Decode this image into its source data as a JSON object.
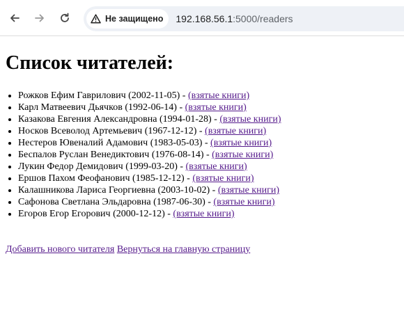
{
  "browser": {
    "security_label": "Не защищено",
    "url_host": "192.168.56.1",
    "url_path": ":5000/readers"
  },
  "page": {
    "title": "Список читателей:",
    "link_label": "(взятые книги)",
    "readers": [
      {
        "name": "Рожков Ефим Гаврилович",
        "birth": "(2002-11-05) - "
      },
      {
        "name": "Карл Матвеевич Дьячков",
        "birth": "(1992-06-14) - "
      },
      {
        "name": "Казакова Евгения Александровна",
        "birth": "(1994-01-28) - "
      },
      {
        "name": "Носков Всеволод Артемьевич",
        "birth": "(1967-12-12) - "
      },
      {
        "name": "Нестеров Ювеналий Адамович",
        "birth": "(1983-05-03) - "
      },
      {
        "name": "Беспалов Руслан Венедиктович",
        "birth": "(1976-08-14) - "
      },
      {
        "name": "Лукин Федор Демидович",
        "birth": "(1999-03-20) - "
      },
      {
        "name": "Ершов Пахом Феофанович",
        "birth": "(1985-12-12) - "
      },
      {
        "name": "Калашникова Лариса Георгиевна",
        "birth": "(2003-10-02) - "
      },
      {
        "name": "Сафонова Светлана Эльдаровна",
        "birth": "(1987-06-30) - "
      },
      {
        "name": "Егоров Егор Егорович",
        "birth": "(2000-12-12) - "
      }
    ],
    "add_reader_label": "Добавить нового читателя",
    "back_home_label": "Вернуться на главную страницу"
  },
  "colors": {
    "link_visited": "#551a8b",
    "omnibox_bg": "#eef1f6"
  },
  "icons": {
    "back": "arrow-left-icon",
    "forward": "arrow-right-icon",
    "reload": "reload-icon",
    "security": "warning-triangle-icon"
  }
}
